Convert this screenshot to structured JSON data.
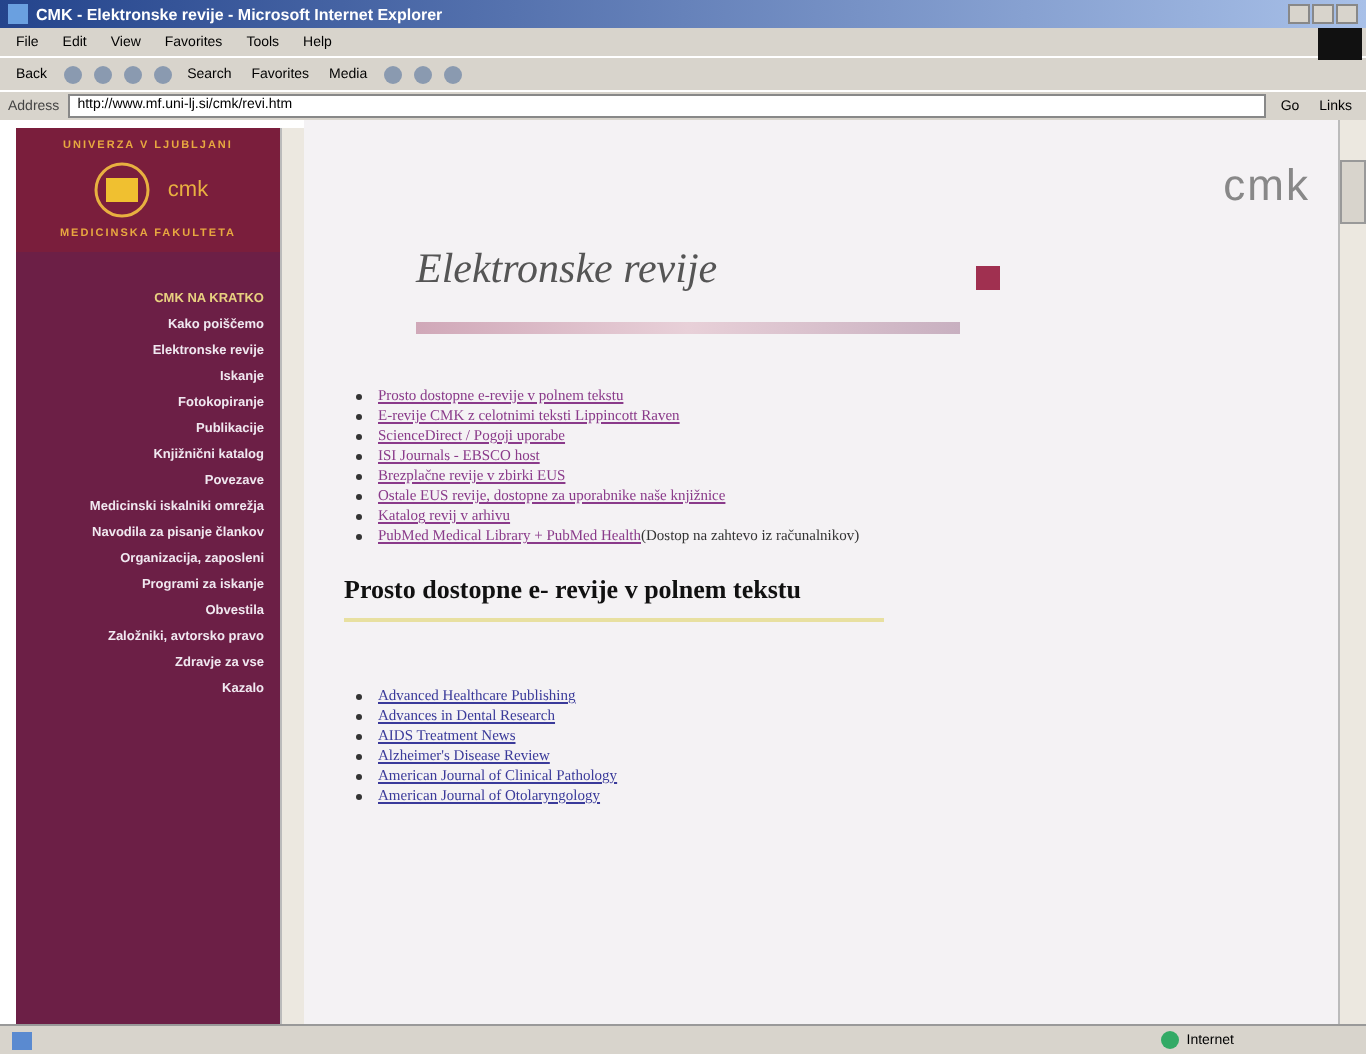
{
  "window": {
    "title": "CMK - Elektronske revije - Microsoft Internet Explorer"
  },
  "menu": [
    "File",
    "Edit",
    "View",
    "Favorites",
    "Tools",
    "Help"
  ],
  "toolbar": [
    {
      "label": "Back"
    },
    {
      "label": "Search"
    },
    {
      "label": "Favorites"
    },
    {
      "label": "Media"
    }
  ],
  "address_bar": {
    "label": "Address",
    "value": "http://www.mf.uni-lj.si/cmk/revi.htm",
    "go": "Go",
    "links": "Links"
  },
  "sidebar": {
    "top_text": "UNIVERZA V LJUBLJANI",
    "logo_text": "cmk",
    "bottom_text": "MEDICINSKA FAKULTETA",
    "items": [
      {
        "label": "CMK NA KRATKO",
        "selected": true
      },
      {
        "label": "Kako poiščemo",
        "selected": false
      },
      {
        "label": "Elektronske revije",
        "selected": false
      },
      {
        "label": "Iskanje",
        "selected": false
      },
      {
        "label": "Fotokopiranje",
        "selected": false
      },
      {
        "label": "Publikacije",
        "selected": false
      },
      {
        "label": "Knjižnični katalog",
        "selected": false
      },
      {
        "label": "Povezave",
        "selected": false
      },
      {
        "label": "Medicinski iskalniki omrežja",
        "selected": false
      },
      {
        "label": "Navodila za pisanje člankov",
        "selected": false
      },
      {
        "label": "Organizacija, zaposleni",
        "selected": false
      },
      {
        "label": "Programi za iskanje",
        "selected": false
      },
      {
        "label": "Obvestila",
        "selected": false
      },
      {
        "label": "Založniki, avtorsko pravo",
        "selected": false
      },
      {
        "label": "Zdravje za vse",
        "selected": false
      },
      {
        "label": "Kazalo",
        "selected": false
      }
    ]
  },
  "page": {
    "logo": "cmk",
    "title": "Elektronske revije",
    "links": [
      {
        "text": "Prosto dostopne e-revije v polnem tekstu"
      },
      {
        "text": "E-revije CMK z celotnimi teksti Lippincott Raven"
      },
      {
        "text": "ScienceDirect / Pogoji uporabe"
      },
      {
        "text": "ISI Journals - EBSCO host"
      },
      {
        "text": "Brezplačne revije v zbirki EUS"
      },
      {
        "text": "Ostale EUS revije, dostopne za uporabnike naše knjižnice"
      },
      {
        "text": "Katalog revij v arhivu"
      },
      {
        "text": "PubMed Medical Library + PubMed Health",
        "note": "(Dostop na zahtevo iz računalnikov)"
      }
    ],
    "heading": "Prosto dostopne e- revije v polnem tekstu",
    "journals": [
      "Advanced Healthcare Publishing",
      "Advances in Dental Research",
      "AIDS Treatment News",
      "Alzheimer's Disease Review",
      "American Journal of Clinical Pathology",
      "American Journal of Otolaryngology"
    ]
  },
  "status_bar": {
    "zone": "Internet"
  }
}
